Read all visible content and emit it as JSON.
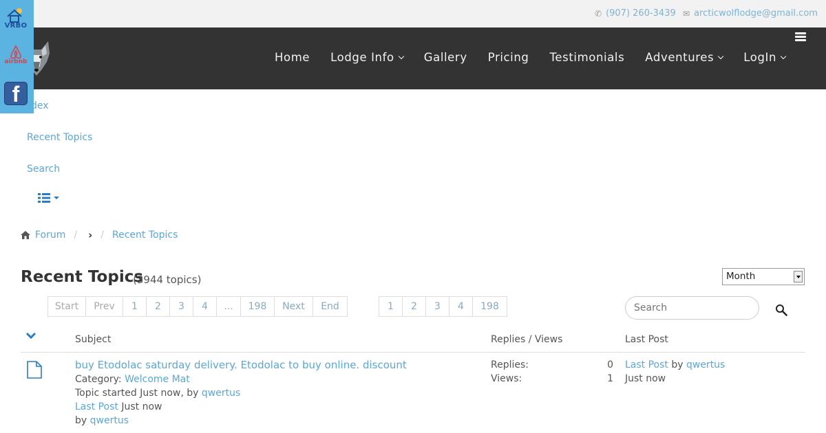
{
  "topbar": {
    "phone": "(907) 260-3439",
    "email": "arcticwolflodge@gmail.com"
  },
  "social": {
    "vrbo": "VRBO",
    "airbnb": "airbnb"
  },
  "nav": {
    "items": [
      {
        "label": "Home",
        "dropdown": false
      },
      {
        "label": "Lodge Info",
        "dropdown": true
      },
      {
        "label": "Gallery",
        "dropdown": false
      },
      {
        "label": "Pricing",
        "dropdown": false
      },
      {
        "label": "Testimonials",
        "dropdown": false
      },
      {
        "label": "Adventures",
        "dropdown": true
      },
      {
        "label": "LogIn",
        "dropdown": true
      }
    ]
  },
  "forum_menu": {
    "index": "dex",
    "recent": "Recent Topics",
    "search": "Search"
  },
  "breadcrumb": {
    "forum": "Forum",
    "separator": "/",
    "current": "Recent Topics"
  },
  "heading": {
    "title": "Recent Topics",
    "count": "(3944 topics)"
  },
  "filter": {
    "selected": "Month"
  },
  "pager_a": [
    "Start",
    "Prev",
    "1",
    "2",
    "3",
    "4",
    "...",
    "198",
    "Next",
    "End"
  ],
  "pager_b": [
    "1",
    "2",
    "3",
    "4",
    "198"
  ],
  "search": {
    "placeholder": "Search"
  },
  "table": {
    "headers": {
      "subject": "Subject",
      "replies_views": "Replies / Views",
      "last_post": "Last Post"
    },
    "rows": [
      {
        "title": "buy Etodolac saturday delivery. Etodolac to buy online. discount",
        "category_label": "Category:",
        "category": "Welcome Mat",
        "started_text": "Topic started Just now, by",
        "started_by": "qwertus",
        "last_post_link": "Last Post",
        "last_post_time": "Just now",
        "by_label": "by",
        "last_by": "qwertus",
        "replies_label": "Replies:",
        "replies": "0",
        "views_label": "Views:",
        "views": "1",
        "lp_link": "Last Post",
        "lp_by_label": "by",
        "lp_user": "qwertus",
        "lp_time": "Just now"
      }
    ]
  },
  "colors": {
    "link": "#5aa7d8",
    "navbar": "#333333",
    "social_bg": "#5ab3e0"
  }
}
